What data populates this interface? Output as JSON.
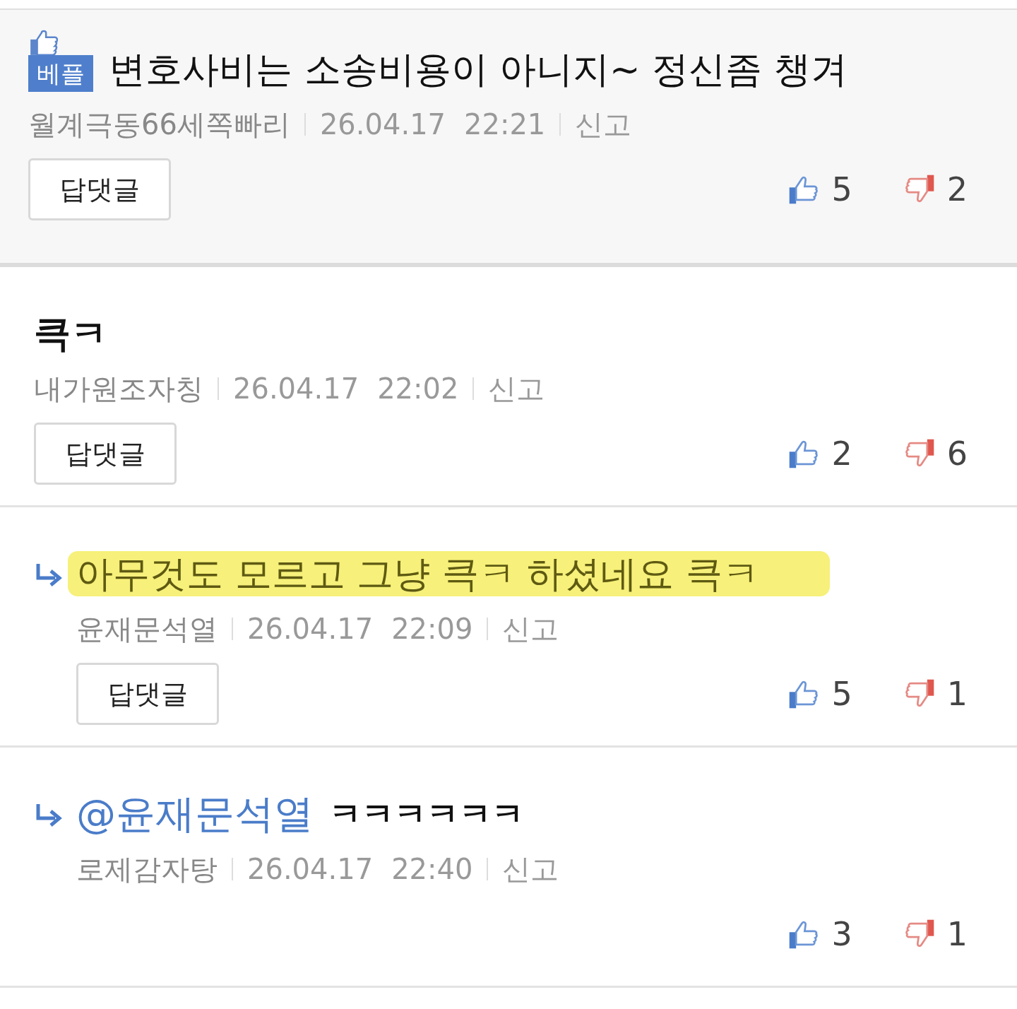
{
  "comments": [
    {
      "best": true,
      "badge": "베플",
      "reply": false,
      "highlighted": false,
      "text": "변호사비는 소송비용이 아니지~ 정신좀 챙겨",
      "author": "월계극동66세쪽빠리",
      "date": "26.04.17",
      "time": "22:21",
      "report": "신고",
      "reply_button": "답댓글",
      "likes": "5",
      "dislikes": "2"
    },
    {
      "best": false,
      "reply": false,
      "highlighted": false,
      "text": "큭ㅋ",
      "author": "내가원조자칭",
      "date": "26.04.17",
      "time": "22:02",
      "report": "신고",
      "reply_button": "답댓글",
      "likes": "2",
      "dislikes": "6"
    },
    {
      "best": false,
      "reply": true,
      "highlighted": true,
      "text": "아무것도 모르고 그냥 큭ㅋ 하셨네요 큭ㅋ",
      "author": "윤재문석열",
      "date": "26.04.17",
      "time": "22:09",
      "report": "신고",
      "reply_button": "답댓글",
      "likes": "5",
      "dislikes": "1"
    },
    {
      "best": false,
      "reply": true,
      "highlighted": false,
      "mention": "@윤재문석열",
      "text": "ㅋㅋㅋㅋㅋㅋ",
      "author": "로제감자탕",
      "date": "26.04.17",
      "time": "22:40",
      "report": "신고",
      "likes": "3",
      "dislikes": "1"
    }
  ]
}
